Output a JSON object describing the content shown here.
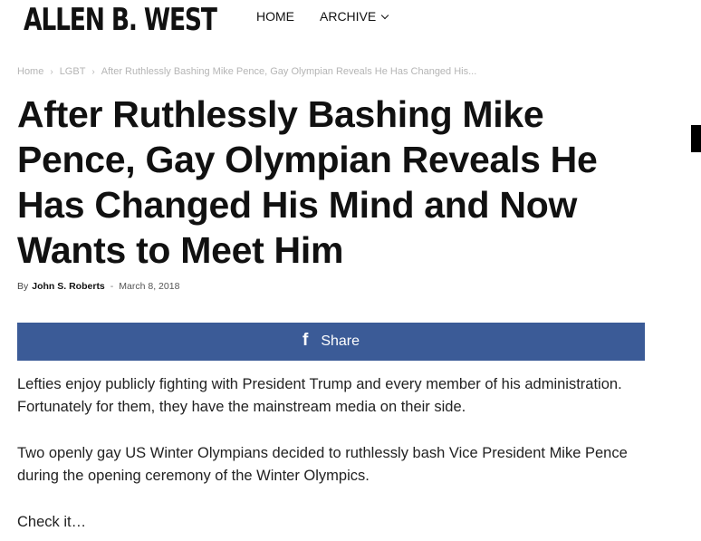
{
  "site": {
    "logo": "ALLEN B. WEST"
  },
  "nav": {
    "home": "HOME",
    "archive": "ARCHIVE"
  },
  "breadcrumb": {
    "home": "Home",
    "category": "LGBT",
    "current": "After Ruthlessly Bashing Mike Pence, Gay Olympian Reveals He Has Changed His...",
    "separator": "›"
  },
  "article": {
    "title": "After Ruthlessly Bashing Mike Pence, Gay Olympian Reveals He Has Changed His Mind and Now Wants to Meet Him",
    "by_label": "By",
    "author": "John S. Roberts",
    "date_separator": "-",
    "date": "March 8, 2018",
    "paragraphs": [
      "Lefties enjoy publicly fighting with President Trump and every member of his administration. Fortunately for them, they have the mainstream media on their side.",
      "Two openly gay US Winter Olympians decided to ruthlessly bash Vice President Mike Pence during the opening ceremony of the Winter Olympics.",
      "Check it…"
    ]
  },
  "share": {
    "icon_glyph": "f",
    "icon_name": "facebook-icon",
    "label": "Share",
    "color": "#3b5b97"
  }
}
